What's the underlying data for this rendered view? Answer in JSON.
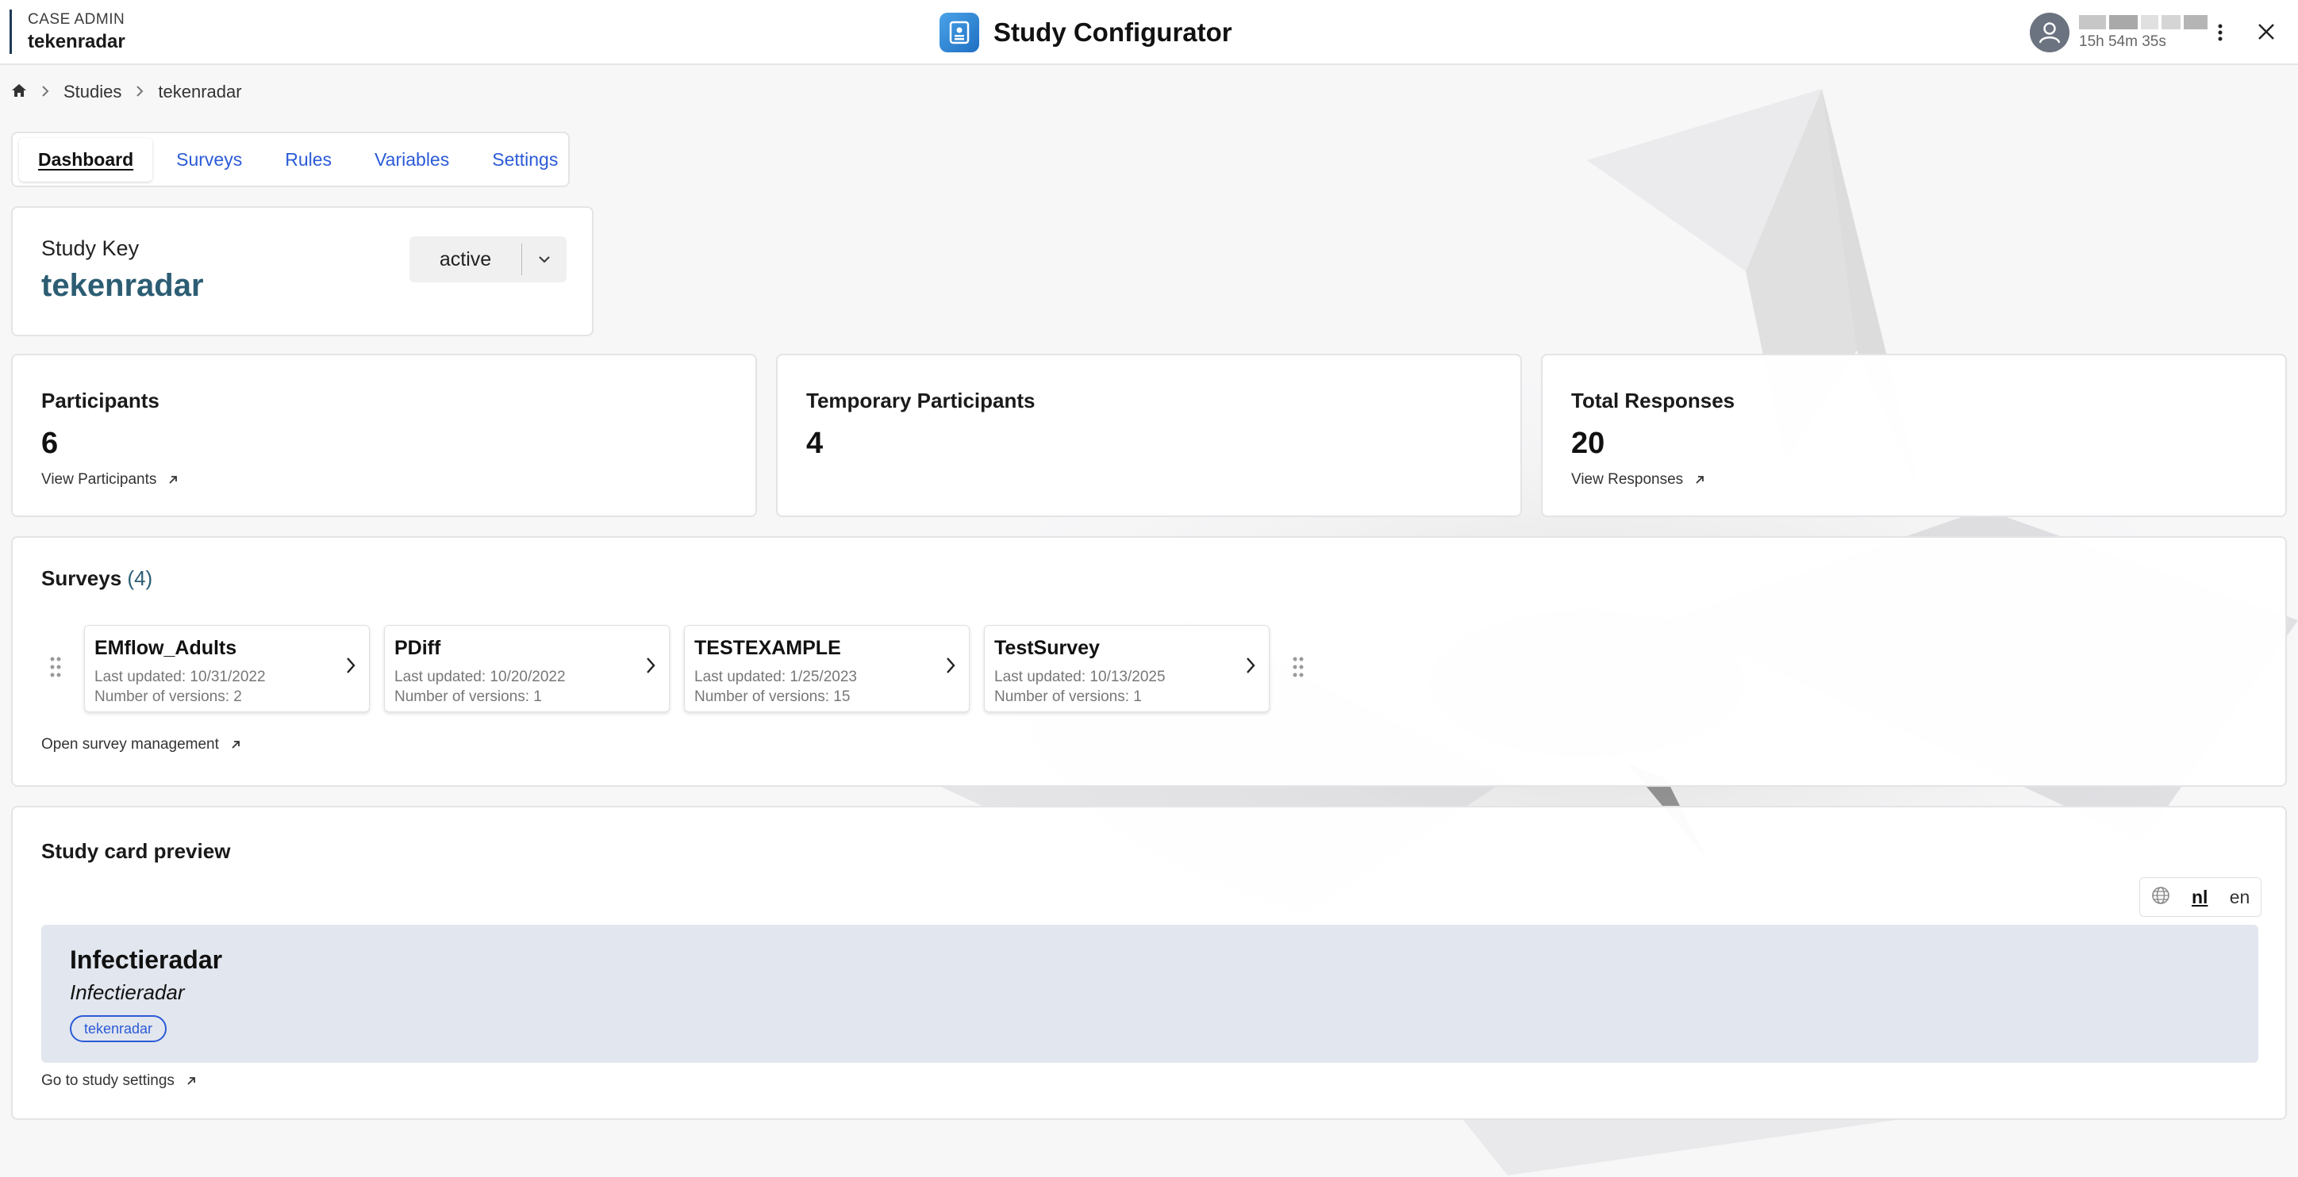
{
  "header": {
    "instance_tag": "CASE ADMIN",
    "instance_name": "tekenradar",
    "app_title": "Study Configurator",
    "session_timer": "15h 54m 35s"
  },
  "breadcrumb": {
    "items": [
      "Studies",
      "tekenradar"
    ]
  },
  "tabs": [
    {
      "label": "Dashboard",
      "active": true
    },
    {
      "label": "Surveys"
    },
    {
      "label": "Rules"
    },
    {
      "label": "Variables"
    },
    {
      "label": "Settings"
    }
  ],
  "study_key": {
    "label": "Study Key",
    "value": "tekenradar",
    "status": "active"
  },
  "stats": [
    {
      "title": "Participants",
      "value": "6",
      "link": "View Participants"
    },
    {
      "title": "Temporary Participants",
      "value": "4"
    },
    {
      "title": "Total Responses",
      "value": "20",
      "link": "View Responses"
    }
  ],
  "surveys": {
    "title": "Surveys",
    "count": "(4)",
    "items": [
      {
        "name": "EMflow_Adults",
        "updated": "Last updated: 10/31/2022",
        "versions": "Number of versions: 2"
      },
      {
        "name": "PDiff",
        "updated": "Last updated: 10/20/2022",
        "versions": "Number of versions: 1"
      },
      {
        "name": "TESTEXAMPLE",
        "updated": "Last updated: 1/25/2023",
        "versions": "Number of versions: 15"
      },
      {
        "name": "TestSurvey",
        "updated": "Last updated: 10/13/2025",
        "versions": "Number of versions: 1"
      }
    ],
    "footer_link": "Open survey management"
  },
  "preview": {
    "title": "Study card preview",
    "languages": [
      {
        "code": "nl",
        "active": true
      },
      {
        "code": "en"
      }
    ],
    "card_title": "Infectieradar",
    "card_subtitle": "Infectieradar",
    "card_tag": "tekenradar",
    "footer_link": "Go to study settings"
  },
  "colors": {
    "accent_blue": "#2b5bd7",
    "study_key_teal": "#2c5d73",
    "preview_bg": "#e2e6ee"
  }
}
